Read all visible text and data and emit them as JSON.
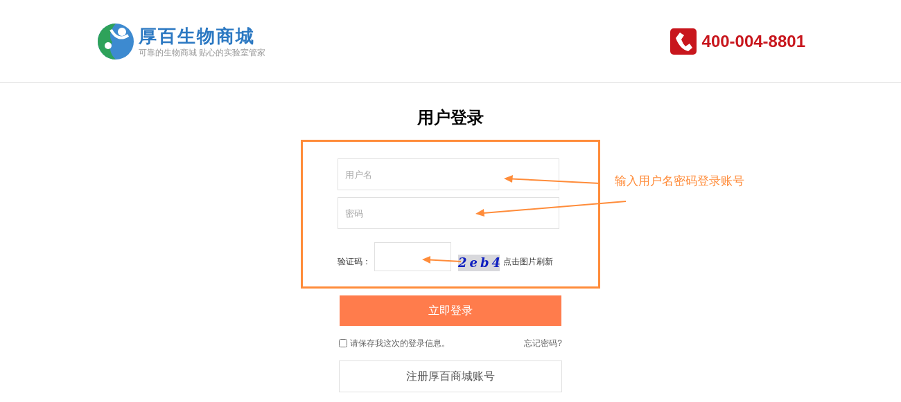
{
  "header": {
    "brand": "厚百生物商城",
    "slogan": "可靠的生物商城 贴心的实验室管家",
    "phone": "400-004-8801"
  },
  "login": {
    "title": "用户登录",
    "username": {
      "placeholder": "用户名"
    },
    "password": {
      "placeholder": "密码"
    },
    "captcha": {
      "label": "验证码：",
      "code": "2eb4",
      "refresh": "点击图片刷新"
    },
    "submit": "立即登录",
    "remember": {
      "label": "请保存我这次的登录信息。",
      "checked": false
    },
    "forgot": "忘记密码?",
    "register": "注册厚百商城账号"
  },
  "annotation": {
    "text": "输入用户名密码登录账号"
  }
}
